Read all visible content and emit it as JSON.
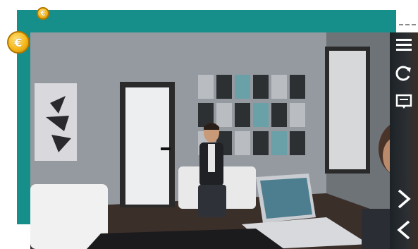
{
  "app": {
    "coin_symbol": "€",
    "accent_color": "#168f8a",
    "coin_color": "#f5b81b"
  },
  "toolbar": {
    "items": [
      {
        "name": "menu",
        "icon": "hamburger-menu-icon"
      },
      {
        "name": "restart",
        "icon": "refresh-icon"
      },
      {
        "name": "subtitles",
        "icon": "subtitles-icon"
      },
      {
        "name": "next",
        "icon": "chevron-right-icon"
      },
      {
        "name": "previous",
        "icon": "chevron-left-icon"
      }
    ]
  },
  "scene": {
    "description_icon": "3d-office-scene"
  }
}
